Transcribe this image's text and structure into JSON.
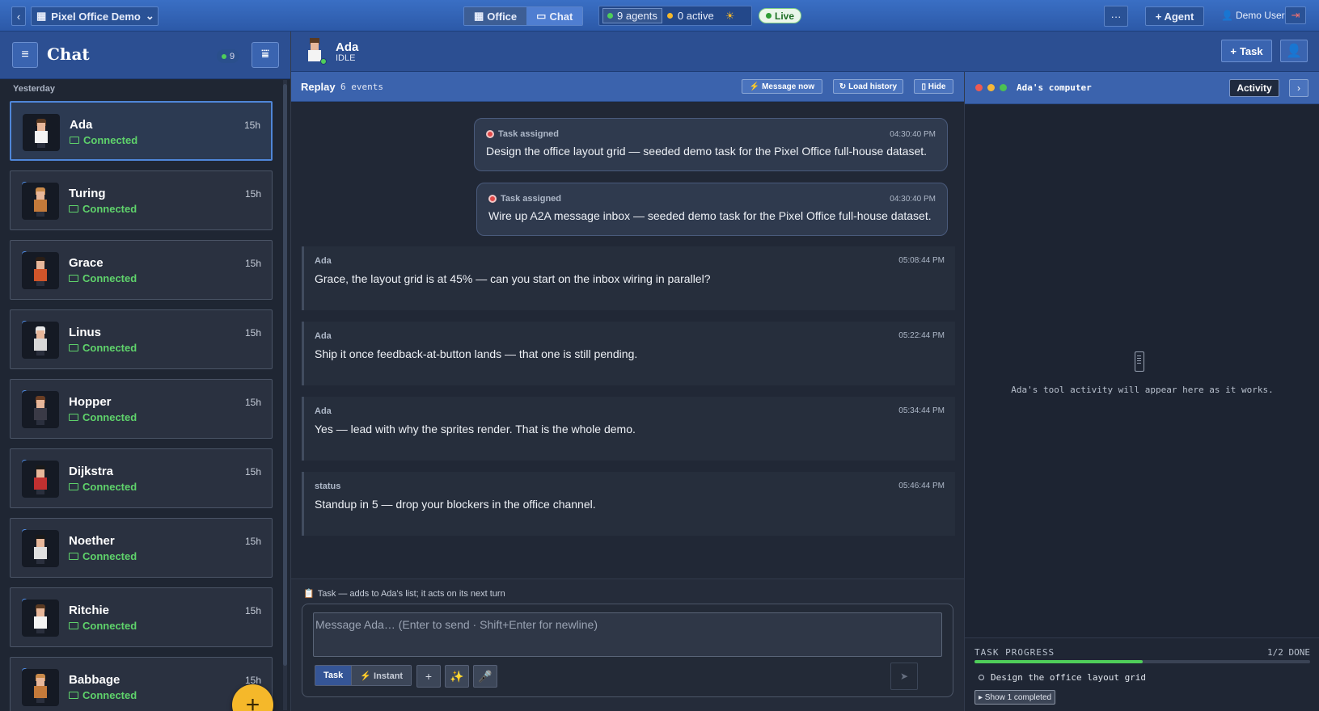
{
  "topbar": {
    "workspace": "Pixel Office Demo",
    "tabs": [
      {
        "label": "Office",
        "icon": "building-icon"
      },
      {
        "label": "Chat",
        "icon": "speech-bubble-icon"
      }
    ],
    "agents_count": "9 agents",
    "active_count": "0 active",
    "live": "Live",
    "more": "···",
    "add_agent": "+ Agent",
    "user": "Demo User",
    "colors": {
      "bar": "#2f5fb0",
      "live_green": "#2e9c36"
    }
  },
  "sidebar": {
    "title": "Chat",
    "count": "9",
    "day_label": "Yesterday",
    "fab": "+",
    "agents": [
      {
        "name": "Ada",
        "time": "15h",
        "status": "Connected",
        "selected": true,
        "hair": "#5a3a22",
        "body": "#f4f4f4"
      },
      {
        "name": "Turing",
        "time": "15h",
        "status": "Connected",
        "hair": "#c98a4a",
        "body": "#c47a3a"
      },
      {
        "name": "Grace",
        "time": "15h",
        "status": "Connected",
        "hair": "#2a1e16",
        "body": "#d0552a"
      },
      {
        "name": "Linus",
        "time": "15h",
        "status": "Connected",
        "hair": "#e8e8e8",
        "body": "#d8d8d8"
      },
      {
        "name": "Hopper",
        "time": "15h",
        "status": "Connected",
        "hair": "#6a3e24",
        "body": "#3a3a46"
      },
      {
        "name": "Dijkstra",
        "time": "15h",
        "status": "Connected",
        "hair": "#1a1a1a",
        "body": "#c03030"
      },
      {
        "name": "Noether",
        "time": "15h",
        "status": "Connected",
        "hair": "#1a1a1a",
        "body": "#e0e0e0"
      },
      {
        "name": "Ritchie",
        "time": "15h",
        "status": "Connected",
        "hair": "#5a3a22",
        "body": "#f4f4f4"
      },
      {
        "name": "Babbage",
        "time": "15h",
        "status": "Connected",
        "hair": "#c98a4a",
        "body": "#c47a3a"
      }
    ]
  },
  "chat": {
    "agent_name": "Ada",
    "agent_state": "IDLE",
    "task_button": "Task",
    "replay": {
      "title": "Replay",
      "events": "6 events",
      "message_now": "⚡ Message now",
      "load_history": "↻ Load history",
      "hide": "▯ Hide"
    },
    "tasks": [
      {
        "label": "Task assigned",
        "time": "04:30:40 PM",
        "text": "Design the office layout grid — seeded demo task for the Pixel Office full-house dataset."
      },
      {
        "label": "Task assigned",
        "time": "04:30:40 PM",
        "text": "Wire up A2A message inbox — seeded demo task for the Pixel Office full-house dataset."
      }
    ],
    "messages": [
      {
        "from": "Ada",
        "time": "05:08:44 PM",
        "text": "Grace, the layout grid is at 45% — can you start on the inbox wiring in parallel?"
      },
      {
        "from": "Ada",
        "time": "05:22:44 PM",
        "text": "Ship it once feedback-at-button lands — that one is still pending."
      },
      {
        "from": "Ada",
        "time": "05:34:44 PM",
        "text": "Yes — lead with why the sprites render. That is the whole demo."
      },
      {
        "from": "status",
        "time": "05:46:44 PM",
        "text": "Standup in 5 — drop your blockers in the office channel."
      }
    ],
    "composer": {
      "hint": "Task — adds to Ada's list; it acts on its next turn",
      "placeholder": "Message Ada…  (Enter to send · Shift+Enter for newline)",
      "mode_task": "Task",
      "mode_instant": "⚡ Instant"
    }
  },
  "computer": {
    "title": "Ada's computer",
    "activity": "Activity",
    "empty": "Ada's tool activity will appear here as it works.",
    "progress": {
      "title": "TASK PROGRESS",
      "count": "1/2 DONE",
      "fraction": 0.5,
      "item": "Design the office layout grid",
      "show_completed": "▸ Show 1 completed"
    }
  }
}
